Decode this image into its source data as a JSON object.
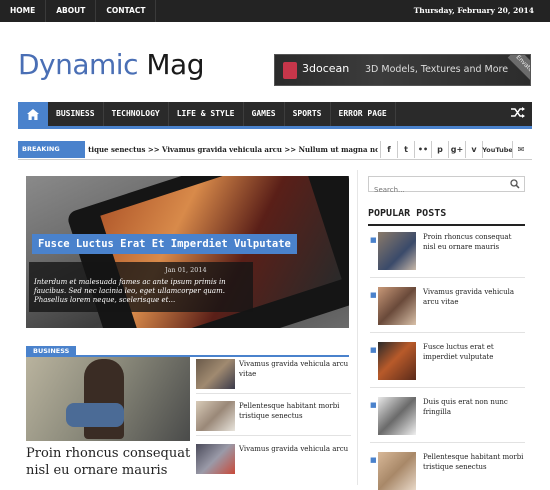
{
  "topbar": {
    "nav": [
      "HOME",
      "ABOUT",
      "CONTACT"
    ],
    "date": "Thursday, February 20, 2014"
  },
  "logo": {
    "part1": "Dynamic",
    "part2": "Mag"
  },
  "banner": {
    "brand": "3docean",
    "tagline": "3D Models, Textures and More",
    "corner": "Envato"
  },
  "mainnav": {
    "items": [
      "BUSINESS",
      "TECHNOLOGY",
      "LIFE & STYLE",
      "GAMES",
      "SPORTS",
      "ERROR PAGE"
    ],
    "home_icon": "home-icon",
    "shuffle_icon": "shuffle-icon"
  },
  "ticker": {
    "label": "BREAKING NEWS",
    "text": "tique senectus  >> Vivamus gravida vehicula arcu  >> Nullum ut magna non lacus adip"
  },
  "social": [
    "f",
    "t",
    "••",
    "p",
    "g+",
    "v",
    "YouTube",
    "✉"
  ],
  "featured": {
    "title": "Fusce Luctus Erat Et Imperdiet Vulputate",
    "date": "Jan 01, 2014",
    "excerpt": "Interdum et malesuada fames ac ante ipsum primis in faucibus. Sed nec lacinia leo, eget ullamcorper quam. Phasellus lorem neque, scelerisque et..."
  },
  "business": {
    "label": "BUSINESS",
    "main_title": "Proin rhoncus consequat nisl eu ornare mauris",
    "items": [
      "Vivamus gravida vehicula arcu vitae",
      "Pellentesque habitant morbi tristique senectus",
      "Vivamus gravida vehicula arcu"
    ]
  },
  "search": {
    "placeholder": "Search..."
  },
  "popular": {
    "heading": "POPULAR POSTS",
    "items": [
      "Proin rhoncus consequat nisl eu ornare mauris",
      "Vivamus gravida vehicula arcu vitae",
      "Fusce luctus erat et imperdiet vulputate",
      "Duis quis erat non nunc fringilla",
      "Pellentesque habitant morbi tristique senectus"
    ]
  },
  "colors": {
    "accent": "#4a82cc",
    "dark": "#2a2a2a"
  }
}
